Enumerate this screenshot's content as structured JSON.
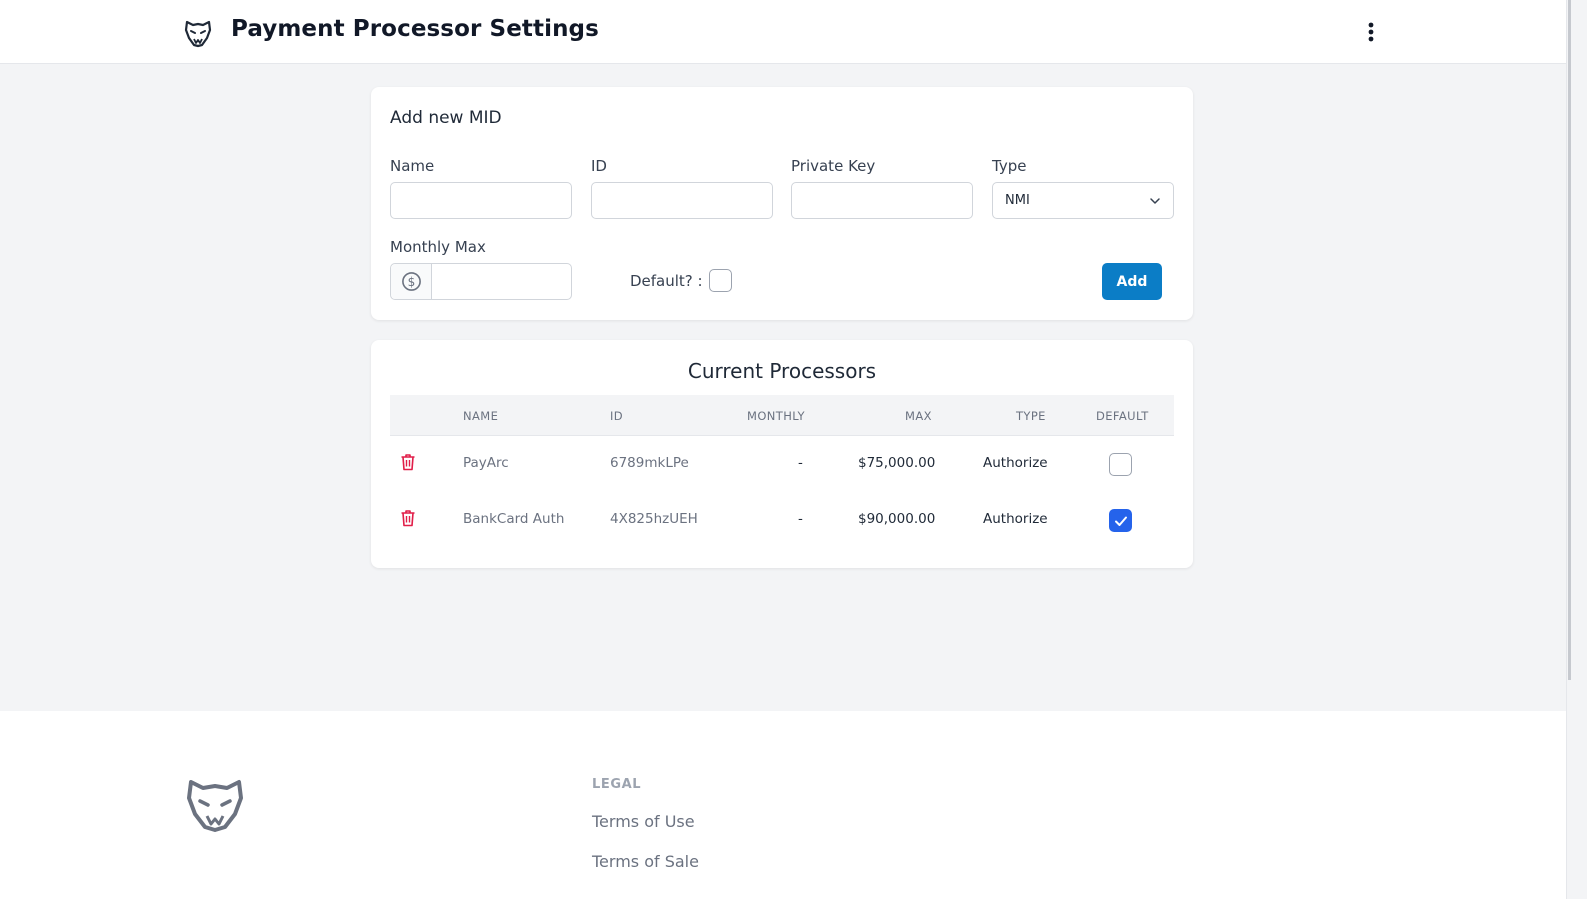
{
  "header": {
    "title": "Payment Processor Settings",
    "logo_icon": "tiger-logo-icon",
    "menu_icon": "kebab-menu-icon"
  },
  "add_form": {
    "title": "Add new MID",
    "name_label": "Name",
    "name_value": "",
    "id_label": "ID",
    "id_value": "",
    "private_key_label": "Private Key",
    "private_key_value": "",
    "type_label": "Type",
    "type_value": "NMI",
    "monthly_max_label": "Monthly Max",
    "monthly_max_value": "",
    "default_label": "Default? :",
    "default_checked": false,
    "add_button": "Add"
  },
  "processors": {
    "title": "Current Processors",
    "columns": [
      "NAME",
      "ID",
      "MONTHLY",
      "MAX",
      "TYPE",
      "DEFAULT"
    ],
    "rows": [
      {
        "name": "PayArc",
        "id": "6789mkLPe",
        "monthly": "-",
        "max": "$75,000.00",
        "type": "Authorize",
        "default": false
      },
      {
        "name": "BankCard Auth",
        "id": "4X825hzUEH",
        "monthly": "-",
        "max": "$90,000.00",
        "type": "Authorize",
        "default": true
      }
    ]
  },
  "footer": {
    "legal_heading": "LEGAL",
    "terms_of_use": "Terms of Use",
    "terms_of_sale": "Terms of Sale"
  },
  "colors": {
    "accent": "#0b7dc6",
    "checkbox_checked": "#2563eb",
    "danger": "#e11d48",
    "background": "#f3f4f6"
  }
}
